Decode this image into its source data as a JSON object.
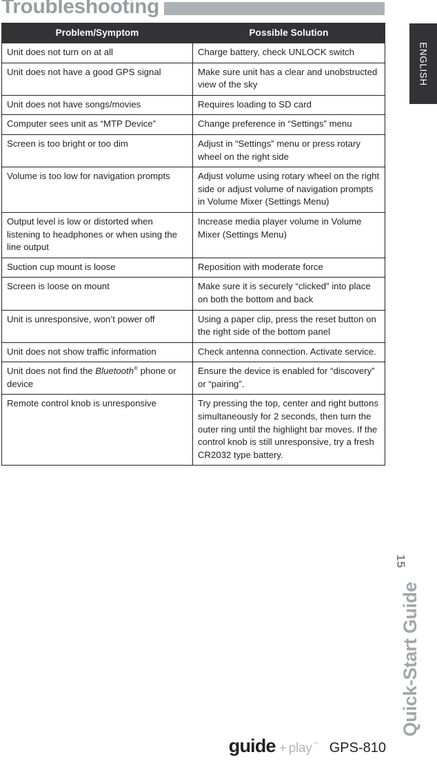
{
  "header": {
    "section_title": "Troubleshooting",
    "rule_color": "#aeb1b5"
  },
  "language_tab": {
    "label": "ENGLISH",
    "background": "#333234",
    "text_color": "#ffffff"
  },
  "table": {
    "header_background": "#333234",
    "columns": [
      "Problem/Symptom",
      "Possible Solution"
    ],
    "rows": [
      {
        "problem": "Unit does not turn on at all",
        "solution": "Charge battery, check UNLOCK switch"
      },
      {
        "problem": "Unit does not have a good GPS signal",
        "solution": "Make sure unit has a clear and unobstructed view of the sky"
      },
      {
        "problem": "Unit does not have songs/movies",
        "solution": "Requires loading to SD card"
      },
      {
        "problem": "Computer sees unit as “MTP Device”",
        "solution": "Change preference in “Settings” menu"
      },
      {
        "problem": "Screen is too bright or too dim",
        "solution": "Adjust in “Settings” menu or press rotary wheel on the right side"
      },
      {
        "problem": "Volume is too low for navigation prompts",
        "solution": "Adjust volume using rotary wheel on the right side or adjust volume of navigation prompts in Volume Mixer (Settings Menu)"
      },
      {
        "problem": "Output level is low or distorted when listening to headphones or when using the line output",
        "solution": "Increase media player volume in Volume Mixer (Settings Menu)"
      },
      {
        "problem": "Suction cup mount is loose",
        "solution": "Reposition with moderate force"
      },
      {
        "problem": "Screen is loose on mount",
        "solution": "Make sure it is securely “clicked” into place on both the bottom and back"
      },
      {
        "problem": "Unit is unresponsive, won’t power off",
        "solution": "Using a paper clip, press the reset button on the right side of the bottom panel"
      },
      {
        "problem": "Unit does not show traffic information",
        "solution": "Check antenna connection. Activate service."
      },
      {
        "problem_prefix": "Unit does not find the ",
        "problem_italic": "Bluetooth",
        "problem_sup": "®",
        "problem_suffix": " phone or device",
        "solution": "Ensure the device is enabled for “discovery” or “pairing”."
      },
      {
        "problem": "Remote control knob is unresponsive",
        "solution": "Try pressing the top, center and right buttons simultaneously for 2 seconds, then turn the outer ring until the highlight bar moves. If the control knob is still unresponsive, try a fresh CR2032 type battery."
      }
    ]
  },
  "side": {
    "page_number": "15",
    "guide_title": "Quick-Start Guide"
  },
  "footer": {
    "brand_guide": "guide",
    "brand_plus": "+",
    "brand_play": "play",
    "brand_tm": "™",
    "model": "GPS-810"
  }
}
